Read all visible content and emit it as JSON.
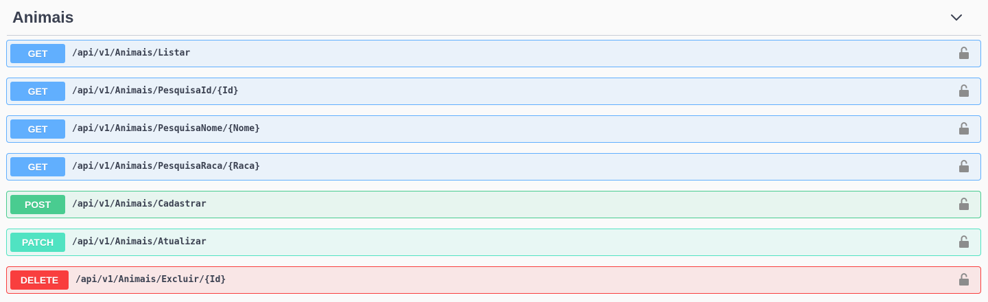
{
  "section": {
    "title": "Animais",
    "toggle_icon": "chevron-down-icon"
  },
  "operations": [
    {
      "method": "GET",
      "path": "/api/v1/Animais/Listar"
    },
    {
      "method": "GET",
      "path": "/api/v1/Animais/PesquisaId/{Id}"
    },
    {
      "method": "GET",
      "path": "/api/v1/Animais/PesquisaNome/{Nome}"
    },
    {
      "method": "GET",
      "path": "/api/v1/Animais/PesquisaRaca/{Raca}"
    },
    {
      "method": "POST",
      "path": "/api/v1/Animais/Cadastrar"
    },
    {
      "method": "PATCH",
      "path": "/api/v1/Animais/Atualizar"
    },
    {
      "method": "DELETE",
      "path": "/api/v1/Animais/Excluir/{Id}"
    }
  ],
  "icons": {
    "lock": "lock-open-icon"
  },
  "colors": {
    "get": "#61afe",
    "post": "#49cc90",
    "patch": "#50e3c2",
    "delete": "#f93e3e",
    "text": "#3b4151"
  }
}
